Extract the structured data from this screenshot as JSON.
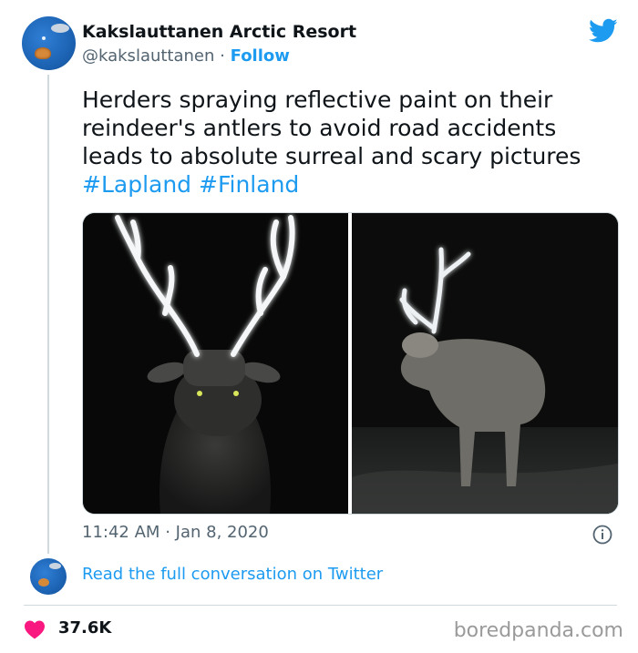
{
  "author": {
    "name": "Kakslauttanen Arctic Resort",
    "handle": "@kakslauttanen",
    "separator": "·",
    "follow_label": "Follow"
  },
  "tweet": {
    "text": "Herders spraying reflective paint on their reindeer's antlers to avoid road accidents leads to absolute surreal and scary pictures ",
    "hashtags": [
      "#Lapland",
      "#Finland"
    ],
    "time": "11:42 AM",
    "date_separator": "·",
    "date": "Jan 8, 2020"
  },
  "conversation": {
    "link_label": "Read the full conversation on Twitter"
  },
  "engagement": {
    "likes": "37.6K"
  },
  "watermark": "boredpanda.com",
  "colors": {
    "brand_blue": "#1d9bf0",
    "heart": "#f91880",
    "text": "#0f1419",
    "secondary": "#536471"
  },
  "icons": [
    "twitter-bird-icon",
    "info-icon",
    "heart-icon"
  ]
}
